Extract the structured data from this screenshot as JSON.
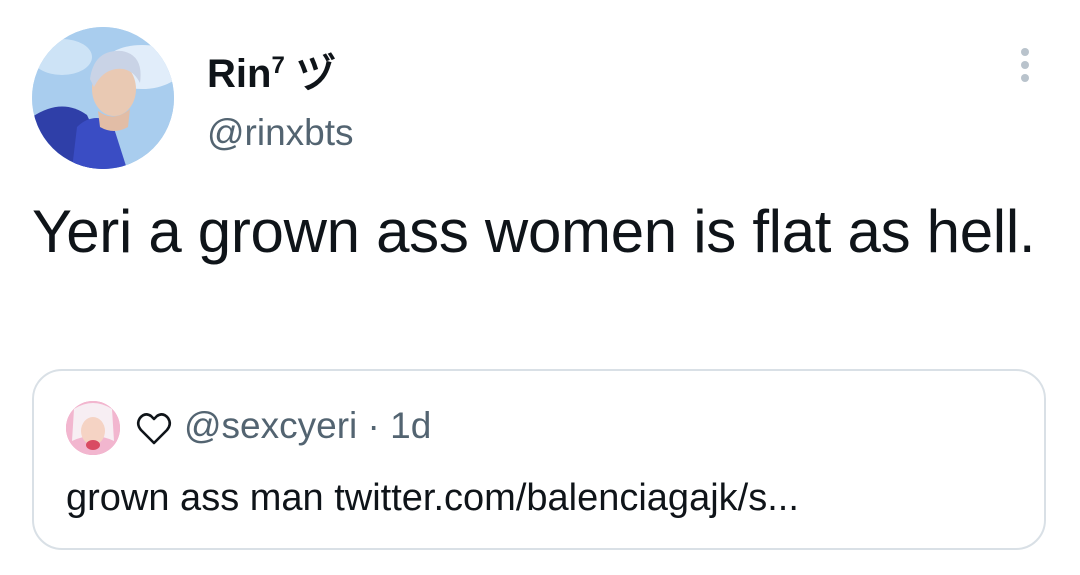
{
  "author": {
    "display_name": "Rin",
    "superscript": "7",
    "name_suffix": "ヅ",
    "handle": "@rinxbts"
  },
  "tweet": {
    "text": "Yeri a grown ass women is flat as hell."
  },
  "quoted_tweet": {
    "handle": "@sexcyeri",
    "separator": "·",
    "time": "1d",
    "text": "grown ass man twitter.com/balenciagajk/s..."
  },
  "icons": {
    "more": "more-options-icon",
    "heart": "heart-outline-icon"
  },
  "colors": {
    "text": "#0f1419",
    "secondary": "#536471",
    "border": "#d9e0e6",
    "more_dots": "#b9c3cc"
  }
}
